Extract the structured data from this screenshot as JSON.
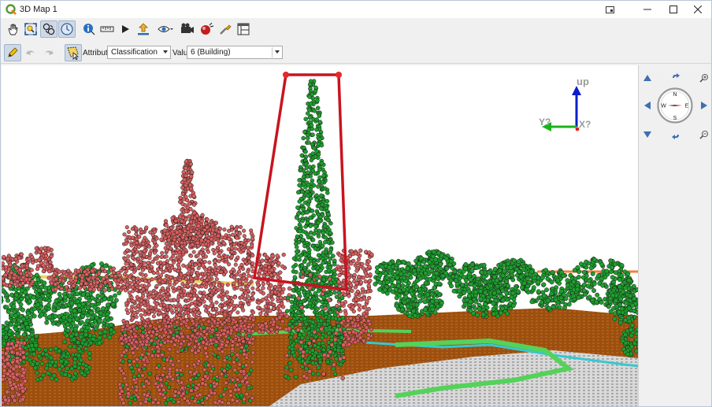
{
  "window": {
    "title": "3D Map 1"
  },
  "toolbar": {
    "tools": [
      {
        "name": "pan-icon",
        "label": "Pan"
      },
      {
        "name": "zoom-full-icon",
        "label": "Zoom Full"
      },
      {
        "name": "toggle-view-icon",
        "label": "2D/3D"
      },
      {
        "name": "camera-control-icon",
        "label": "Camera Control"
      },
      {
        "name": "identify-icon",
        "label": "Identify"
      },
      {
        "name": "measure-icon",
        "label": "Measure"
      },
      {
        "name": "play-icon",
        "label": "Animation"
      },
      {
        "name": "export-icon",
        "label": "Export"
      },
      {
        "name": "view-icon",
        "label": "View"
      },
      {
        "name": "camera-icon",
        "label": "Camera"
      },
      {
        "name": "effects-icon",
        "label": "Effects"
      },
      {
        "name": "settings-icon",
        "label": "Settings"
      },
      {
        "name": "layout-icon",
        "label": "Layout"
      }
    ]
  },
  "editing": {
    "attribute_label": "Attribute",
    "attribute_value": "Classification",
    "value_label": "Value",
    "value_value": "6 (Building)"
  },
  "axis": {
    "up_label": "up",
    "y_label": "Y?",
    "x_label": "X?"
  },
  "compass": {
    "north": "N",
    "south": "S",
    "east": "E",
    "west": "W"
  },
  "colors": {
    "building": "#d95f5f",
    "vegetation": "#1e9e2e",
    "ground": "#9b4f10",
    "selection": "#c8141e",
    "water": "#35c8d0"
  }
}
